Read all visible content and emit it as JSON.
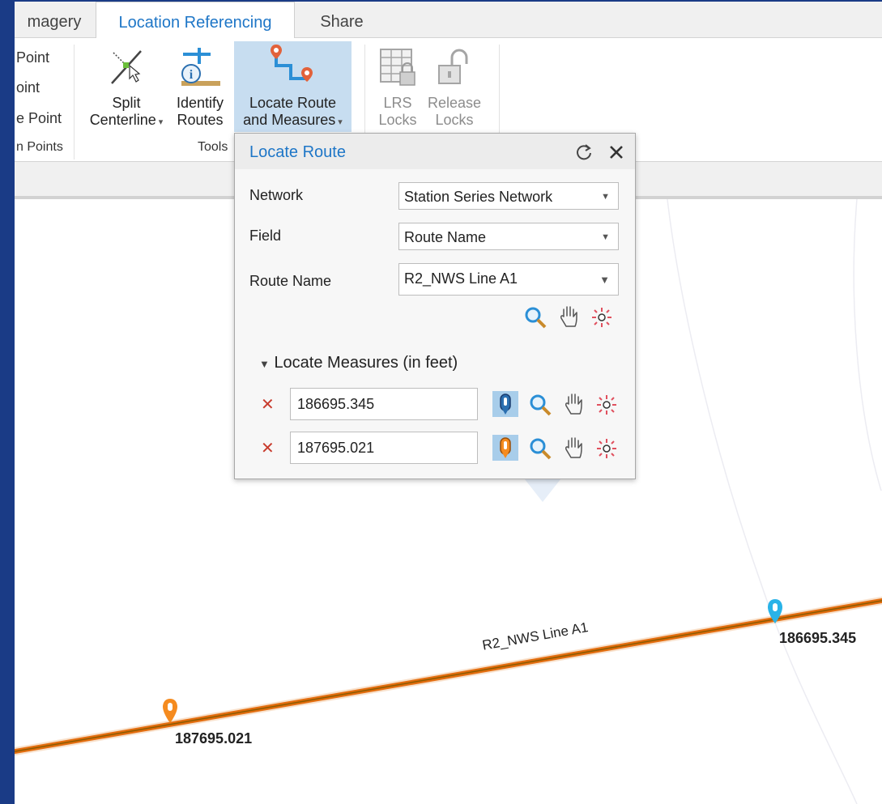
{
  "tabs": [
    {
      "label": "magery",
      "active": false
    },
    {
      "label": "Location Referencing",
      "active": true
    },
    {
      "label": "Share",
      "active": false
    }
  ],
  "ribbon": {
    "left_items": [
      "Point",
      "oint",
      "e Point",
      "n Points"
    ],
    "split_centerline": {
      "line1": "Split",
      "line2": "Centerline"
    },
    "identify_routes": {
      "line1": "Identify",
      "line2": "Routes"
    },
    "locate_route_measures": {
      "line1": "Locate Route",
      "line2": "and Measures"
    },
    "tools_group_label": "Tools",
    "lrs_locks": {
      "line1": "LRS",
      "line2": "Locks"
    },
    "release_locks": {
      "line1": "Release",
      "line2": "Locks"
    }
  },
  "dialog": {
    "title": "Locate Route",
    "network_label": "Network",
    "network_value": "Station Series Network",
    "field_label": "Field",
    "field_value": "Route Name",
    "route_name_label": "Route Name",
    "route_name_value": "R2_NWS Line A1",
    "measures_header": "Locate Measures (in feet)",
    "measure_1": "186695.345",
    "measure_2": "187695.021"
  },
  "map": {
    "route_label": "R2_NWS Line A1",
    "point_1_label": "186695.345",
    "point_2_label": "187695.021"
  },
  "colors": {
    "accent": "#1e76c7",
    "route_line": "#e36d0e",
    "route_line_core": "#8a5a00",
    "pin_blue": "#29b3e8",
    "pin_orange": "#f58b1f",
    "delete_x": "#c83c2e",
    "background": "#1a3b86"
  }
}
